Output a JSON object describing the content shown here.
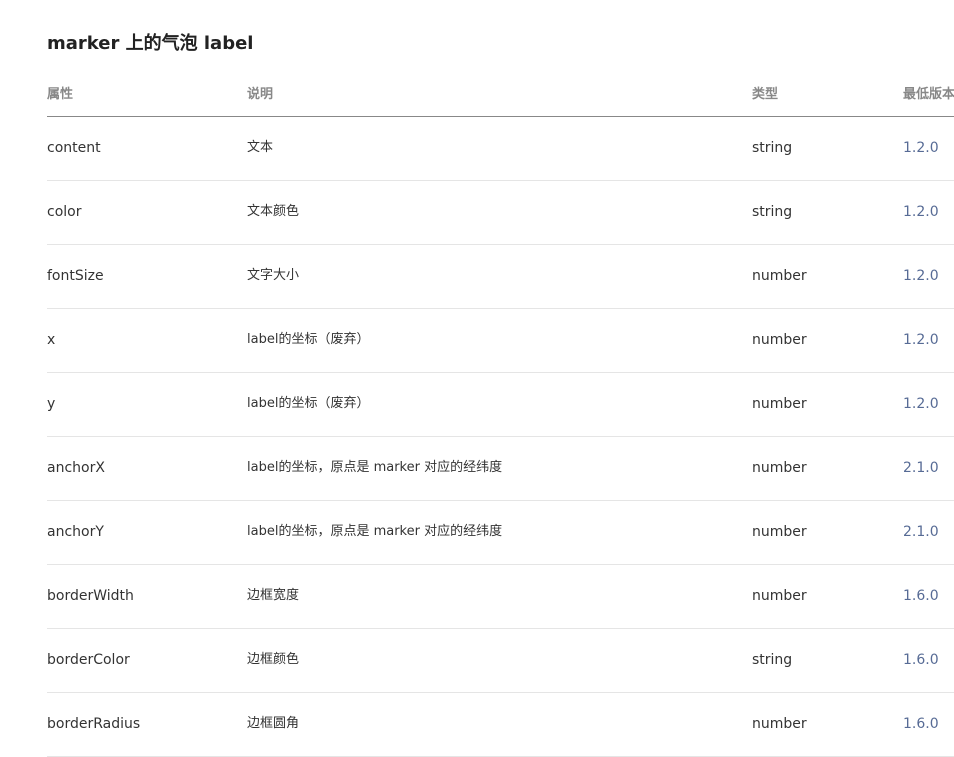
{
  "section": {
    "title": "marker 上的气泡 label"
  },
  "table": {
    "headers": {
      "prop": "属性",
      "desc": "说明",
      "type": "类型",
      "version": "最低版本"
    },
    "rows": [
      {
        "prop": "content",
        "desc": "文本",
        "type": "string",
        "version": "1.2.0"
      },
      {
        "prop": "color",
        "desc": "文本颜色",
        "type": "string",
        "version": "1.2.0"
      },
      {
        "prop": "fontSize",
        "desc": "文字大小",
        "type": "number",
        "version": "1.2.0"
      },
      {
        "prop": "x",
        "desc": "label的坐标（废弃）",
        "type": "number",
        "version": "1.2.0"
      },
      {
        "prop": "y",
        "desc": "label的坐标（废弃）",
        "type": "number",
        "version": "1.2.0"
      },
      {
        "prop": "anchorX",
        "desc": "label的坐标，原点是 marker 对应的经纬度",
        "type": "number",
        "version": "2.1.0"
      },
      {
        "prop": "anchorY",
        "desc": "label的坐标，原点是 marker 对应的经纬度",
        "type": "number",
        "version": "2.1.0"
      },
      {
        "prop": "borderWidth",
        "desc": "边框宽度",
        "type": "number",
        "version": "1.6.0"
      },
      {
        "prop": "borderColor",
        "desc": "边框颜色",
        "type": "string",
        "version": "1.6.0"
      },
      {
        "prop": "borderRadius",
        "desc": "边框圆角",
        "type": "number",
        "version": "1.6.0"
      }
    ]
  },
  "colors": {
    "link": "#576b95",
    "header_text": "#888888",
    "body_text": "#333333",
    "divider": "#e5e5e5"
  }
}
